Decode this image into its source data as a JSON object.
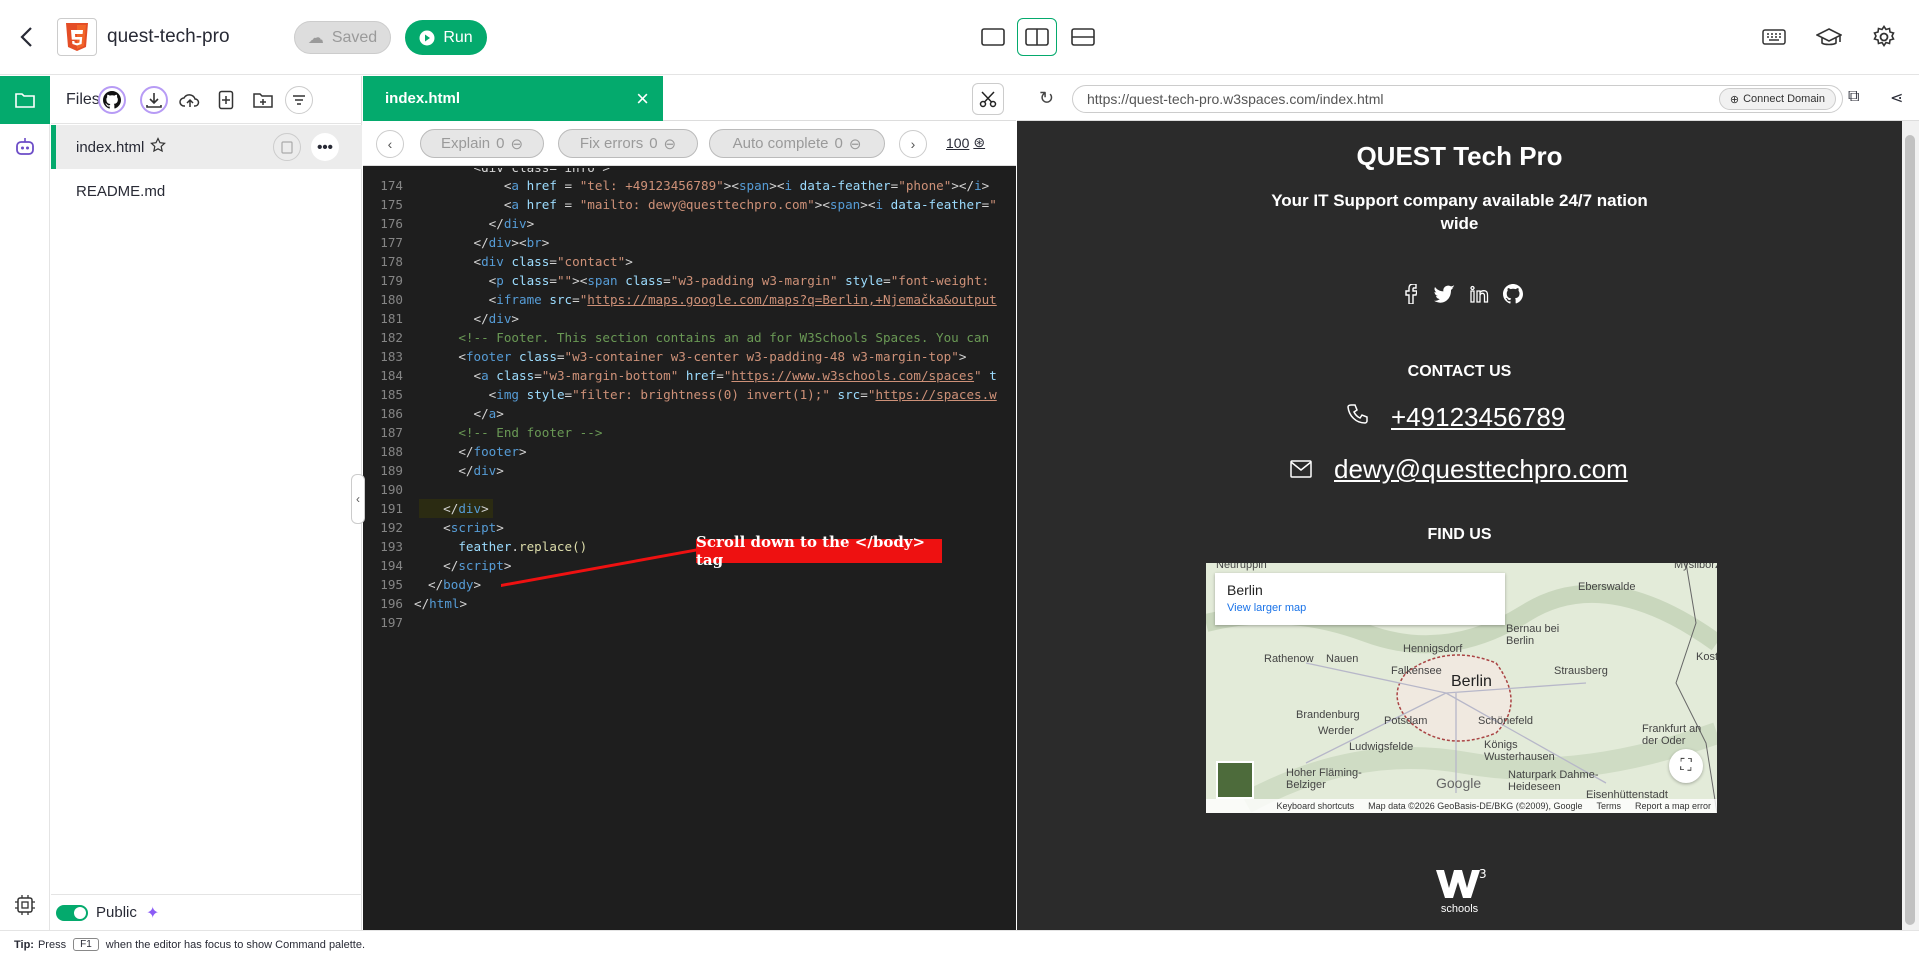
{
  "header": {
    "project_name": "quest-tech-pro",
    "saved_label": "Saved",
    "run_label": "Run"
  },
  "sidebar": {
    "title": "Files",
    "files": [
      {
        "name": "index.html",
        "active": true
      },
      {
        "name": "README.md",
        "active": false
      }
    ],
    "public_label": "Public"
  },
  "editor": {
    "tab_label": "index.html",
    "ai_buttons": [
      {
        "label": "Explain",
        "count": "0"
      },
      {
        "label": "Fix errors",
        "count": "0"
      },
      {
        "label": "Auto complete",
        "count": "0"
      }
    ],
    "zoom": "100",
    "line_numbers": [
      "174",
      "175",
      "176",
      "177",
      "178",
      "179",
      "180",
      "181",
      "182",
      "183",
      "184",
      "185",
      "186",
      "187",
      "188",
      "189",
      "190",
      "191",
      "192",
      "193",
      "194",
      "195",
      "196",
      "197"
    ],
    "callout": "Scroll down to the </body> tag"
  },
  "preview": {
    "url": "https://quest-tech-pro.w3spaces.com/index.html",
    "connect_label": "Connect Domain",
    "site_title": "QUEST Tech Pro",
    "tagline": "Your IT Support company available 24/7 nation wide",
    "contact_heading": "CONTACT US",
    "phone": "+49123456789",
    "email": "dewy@questtechpro.com",
    "find_heading": "FIND US",
    "map": {
      "place": "Berlin",
      "larger_map_link": "View larger map",
      "labels": [
        "Neuruppin",
        "Eberswalde",
        "Bernau bei Berlin",
        "Hennigsdorf",
        "Rathenow",
        "Nauen",
        "Falkensee",
        "Strausberg",
        "Brandenburg",
        "Potsdam",
        "Schönefeld",
        "Werder",
        "Ludwigsfelde",
        "Königs Wusterhausen",
        "Frankfurt an der Oder",
        "Hoher Fläming-Belziger",
        "Naturpark Dahme-Heideseen",
        "Eisenhüttenstadt",
        "Myslibórz",
        "Kost"
      ],
      "city": "Berlin",
      "footer": [
        "Keyboard shortcuts",
        "Map data ©2026 GeoBasis-DE/BKG (©2009), Google",
        "Terms",
        "Report a map error"
      ]
    },
    "footer_brand": "schools"
  },
  "status": {
    "tip_label": "Tip:",
    "tip_pre": "Press",
    "tip_key": "F1",
    "tip_post": "when the editor has focus to show Command palette."
  },
  "colors": {
    "accent": "#04aa6d",
    "editor_bg": "#1e1e1e",
    "preview_bg": "#2b2b2b",
    "callout": "#ee1111"
  }
}
